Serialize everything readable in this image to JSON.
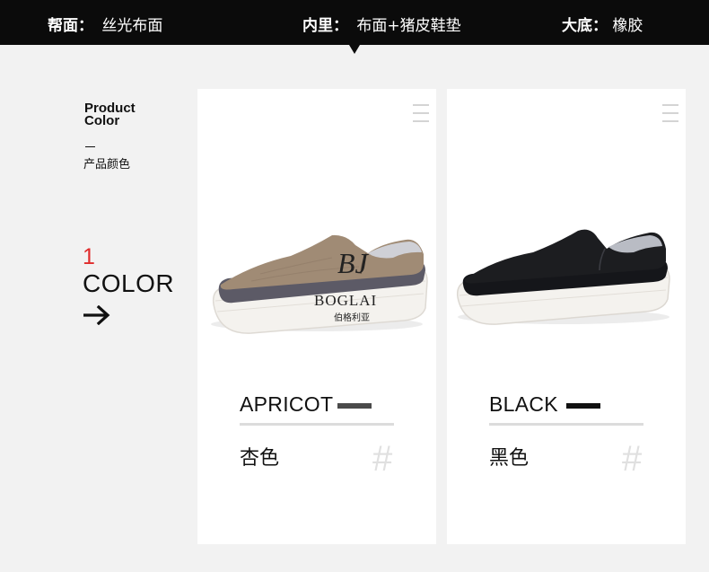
{
  "specs": [
    {
      "label": "帮面：",
      "value": "丝光布面"
    },
    {
      "label": "内里：",
      "value": "布面+猪皮鞋垫"
    },
    {
      "label": "大底：",
      "value": "橡胶"
    }
  ],
  "section": {
    "title_line1": "Product",
    "title_line2": "Color",
    "title_cn": "产品颜色",
    "count": "1",
    "count_word": "COLOR"
  },
  "products": [
    {
      "name": "APRICOT",
      "name_cn": "杏色",
      "swatch_color": "#4a4a4a",
      "shoe_upper": "#a08b75",
      "brand_mark": "BJ",
      "brand": "BOGLAI",
      "brand_cn": "伯格利亚",
      "hash": "#"
    },
    {
      "name": "BLACK",
      "name_cn": "黑色",
      "swatch_color": "#111111",
      "shoe_upper": "#1c1d20",
      "hash": "#"
    }
  ]
}
